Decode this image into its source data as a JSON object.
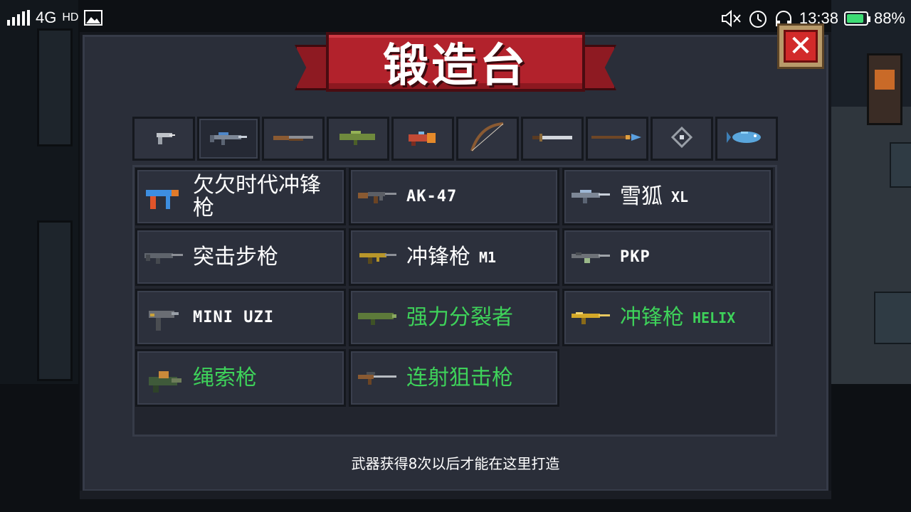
{
  "status_bar": {
    "network": "4G",
    "hd": "HD",
    "time": "13:38",
    "battery": "88%",
    "battery_level": 0.88
  },
  "panel": {
    "title": "锻造台",
    "close_label": "✕",
    "hint": "武器获得8次以后才能在这里打造"
  },
  "tabs": [
    {
      "icon": "pistol-icon"
    },
    {
      "icon": "rifle-icon"
    },
    {
      "icon": "shotgun-icon"
    },
    {
      "icon": "rocket-launcher-icon"
    },
    {
      "icon": "special-gun-icon"
    },
    {
      "icon": "bow-icon"
    },
    {
      "icon": "sword-icon"
    },
    {
      "icon": "spear-icon"
    },
    {
      "icon": "staff-icon"
    },
    {
      "icon": "fish-icon"
    }
  ],
  "weapons": [
    {
      "name": "欠欠时代冲锋枪",
      "icon": "smg-icon",
      "color": "#ffffff"
    },
    {
      "name": "AK-47",
      "icon": "ak47-icon",
      "color": "#ffffff"
    },
    {
      "name": "雪狐",
      "suffix": "XL",
      "icon": "snowfox-rifle-icon",
      "color": "#ffffff"
    },
    {
      "name": "突击步枪",
      "icon": "assault-rifle-icon",
      "color": "#ffffff"
    },
    {
      "name": "冲锋枪",
      "suffix": "M1",
      "icon": "smg-m1-icon",
      "color": "#ffffff"
    },
    {
      "name": "PKP",
      "icon": "pkp-icon",
      "color": "#ffffff"
    },
    {
      "name": "MINI UZI",
      "icon": "uzi-icon",
      "color": "#ffffff"
    },
    {
      "name": "强力分裂者",
      "icon": "splitter-icon",
      "color": "#3ed25a"
    },
    {
      "name": "冲锋枪",
      "suffix": "HELIX",
      "icon": "smg-helix-icon",
      "color": "#3ed25a"
    },
    {
      "name": "绳索枪",
      "icon": "rope-gun-icon",
      "color": "#3ed25a"
    },
    {
      "name": "连射狙击枪",
      "icon": "burst-sniper-icon",
      "color": "#3ed25a"
    }
  ]
}
